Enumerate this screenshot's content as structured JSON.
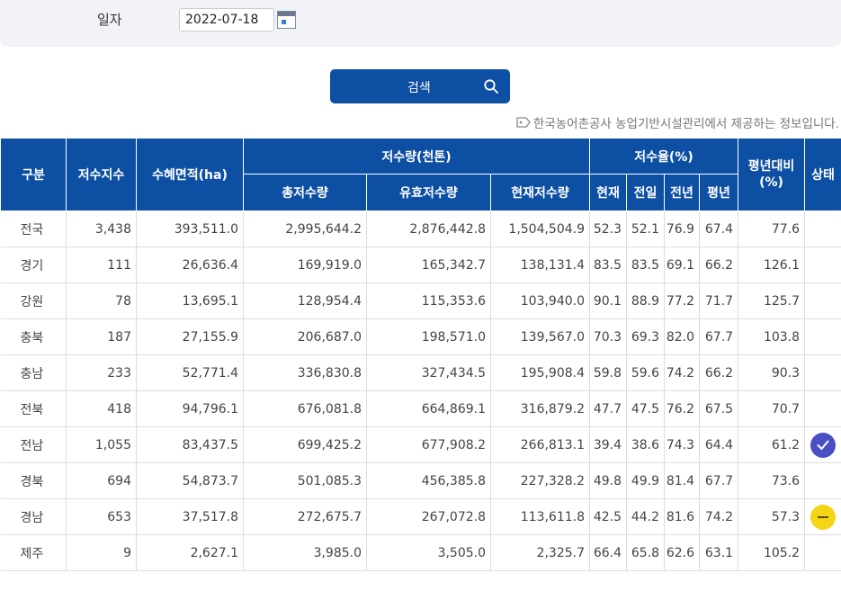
{
  "filter": {
    "date_label": "일자",
    "date_value": "2022-07-18"
  },
  "search": {
    "label": "검색"
  },
  "source_note": "한국농어촌공사 농업기반시설관리에서 제공하는 정보입니다.",
  "table": {
    "headers": {
      "region": "구분",
      "count": "저수지수",
      "area": "수혜면적(ha)",
      "storage_group": "저수량(천톤)",
      "storage_total": "총저수량",
      "storage_valid": "유효저수량",
      "storage_current": "현재저수량",
      "rate_group": "저수율(%)",
      "rate_now": "현재",
      "rate_prev_day": "전일",
      "rate_prev_year": "전년",
      "rate_avg": "평년",
      "vs_avg": "평년대비(%)",
      "status": "상태"
    },
    "rows": [
      {
        "region": "전국",
        "count": "3,438",
        "area": "393,511.0",
        "total": "2,995,644.2",
        "valid": "2,876,442.8",
        "current": "1,504,504.9",
        "now": "52.3",
        "prev_day": "52.1",
        "prev_year": "76.9",
        "avg": "67.4",
        "vs_avg": "77.6",
        "status": ""
      },
      {
        "region": "경기",
        "count": "111",
        "area": "26,636.4",
        "total": "169,919.0",
        "valid": "165,342.7",
        "current": "138,131.4",
        "now": "83.5",
        "prev_day": "83.5",
        "prev_year": "69.1",
        "avg": "66.2",
        "vs_avg": "126.1",
        "status": ""
      },
      {
        "region": "강원",
        "count": "78",
        "area": "13,695.1",
        "total": "128,954.4",
        "valid": "115,353.6",
        "current": "103,940.0",
        "now": "90.1",
        "prev_day": "88.9",
        "prev_year": "77.2",
        "avg": "71.7",
        "vs_avg": "125.7",
        "status": ""
      },
      {
        "region": "충북",
        "count": "187",
        "area": "27,155.9",
        "total": "206,687.0",
        "valid": "198,571.0",
        "current": "139,567.0",
        "now": "70.3",
        "prev_day": "69.3",
        "prev_year": "82.0",
        "avg": "67.7",
        "vs_avg": "103.8",
        "status": ""
      },
      {
        "region": "충남",
        "count": "233",
        "area": "52,771.4",
        "total": "336,830.8",
        "valid": "327,434.5",
        "current": "195,908.4",
        "now": "59.8",
        "prev_day": "59.6",
        "prev_year": "74.2",
        "avg": "66.2",
        "vs_avg": "90.3",
        "status": ""
      },
      {
        "region": "전북",
        "count": "418",
        "area": "94,796.1",
        "total": "676,081.8",
        "valid": "664,869.1",
        "current": "316,879.2",
        "now": "47.7",
        "prev_day": "47.5",
        "prev_year": "76.2",
        "avg": "67.5",
        "vs_avg": "70.7",
        "status": ""
      },
      {
        "region": "전남",
        "count": "1,055",
        "area": "83,437.5",
        "total": "699,425.2",
        "valid": "677,908.2",
        "current": "266,813.1",
        "now": "39.4",
        "prev_day": "38.6",
        "prev_year": "74.3",
        "avg": "64.4",
        "vs_avg": "61.2",
        "status": "check-icon"
      },
      {
        "region": "경북",
        "count": "694",
        "area": "54,873.7",
        "total": "501,085.3",
        "valid": "456,385.8",
        "current": "227,328.2",
        "now": "49.8",
        "prev_day": "49.9",
        "prev_year": "81.4",
        "avg": "67.7",
        "vs_avg": "73.6",
        "status": ""
      },
      {
        "region": "경남",
        "count": "653",
        "area": "37,517.8",
        "total": "272,675.7",
        "valid": "267,072.8",
        "current": "113,611.8",
        "now": "42.5",
        "prev_day": "44.2",
        "prev_year": "81.6",
        "avg": "74.2",
        "vs_avg": "57.3",
        "status": "minus-icon"
      },
      {
        "region": "제주",
        "count": "9",
        "area": "2,627.1",
        "total": "3,985.0",
        "valid": "3,505.0",
        "current": "2,325.7",
        "now": "66.4",
        "prev_day": "65.8",
        "prev_year": "62.6",
        "avg": "63.1",
        "vs_avg": "105.2",
        "status": ""
      }
    ]
  },
  "colors": {
    "header_bg": "#0d4fa2",
    "button_bg": "#0d4fa2",
    "status_check": "#4a4fc4",
    "status_minus": "#f5d517"
  }
}
